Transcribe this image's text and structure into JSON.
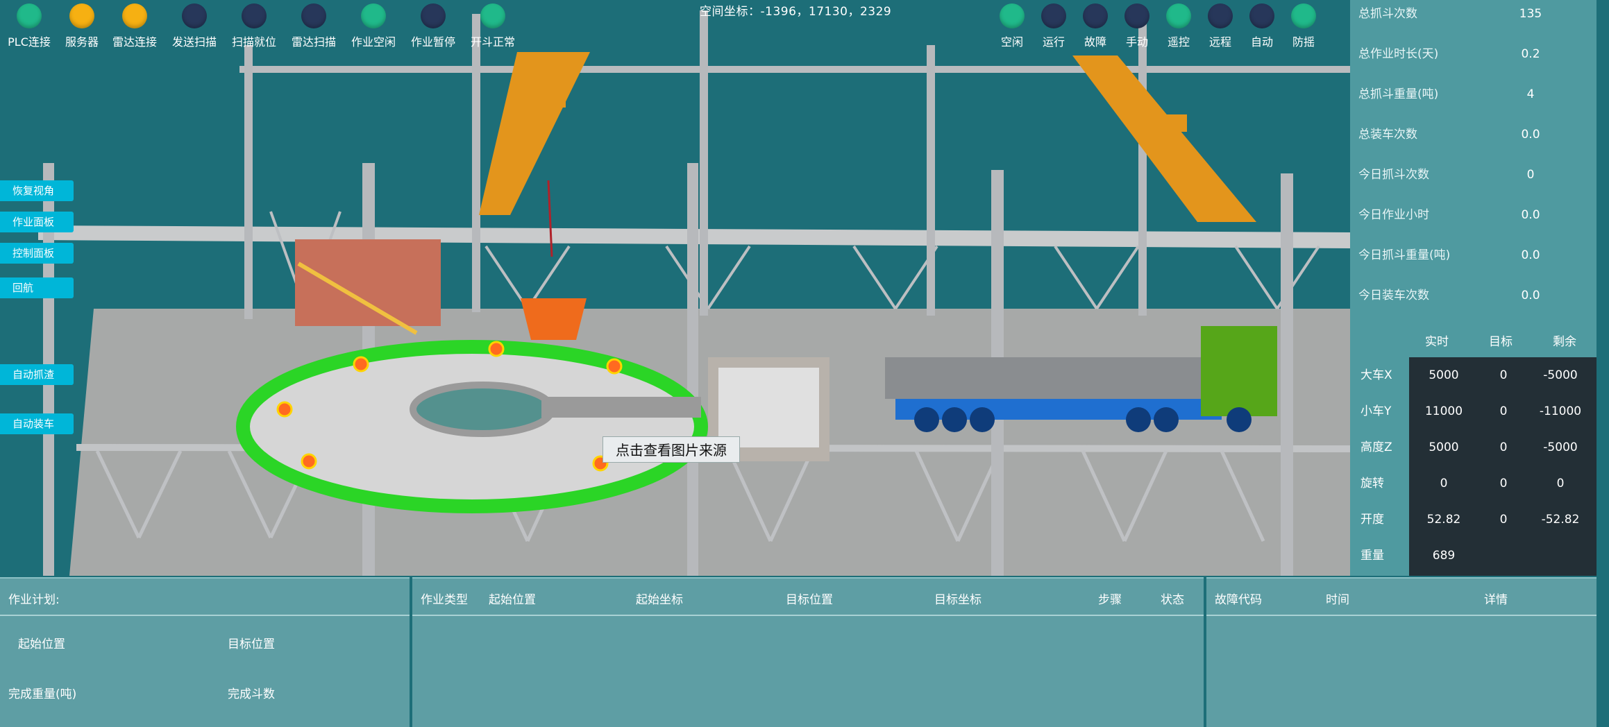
{
  "coords": "空间坐标：-1396，17130，2329",
  "indicators_left": [
    {
      "label": "PLC连接",
      "color": "#20b98a"
    },
    {
      "label": "服务器",
      "color": "#f6b012"
    },
    {
      "label": "雷达连接",
      "color": "#f6b012"
    },
    {
      "label": "发送扫描",
      "color": "#27375a"
    },
    {
      "label": "扫描就位",
      "color": "#27375a"
    },
    {
      "label": "雷达扫描",
      "color": "#27375a"
    },
    {
      "label": "作业空闲",
      "color": "#20b98a"
    },
    {
      "label": "作业暂停",
      "color": "#27375a"
    },
    {
      "label": "开斗正常",
      "color": "#20b98a"
    }
  ],
  "indicators_right": [
    {
      "label": "空闲",
      "color": "#20b98a"
    },
    {
      "label": "运行",
      "color": "#27375a"
    },
    {
      "label": "故障",
      "color": "#27375a"
    },
    {
      "label": "手动",
      "color": "#27375a"
    },
    {
      "label": "遥控",
      "color": "#20b98a"
    },
    {
      "label": "远程",
      "color": "#27375a"
    },
    {
      "label": "自动",
      "color": "#27375a"
    },
    {
      "label": "防摇",
      "color": "#20b98a"
    }
  ],
  "side_buttons": [
    "恢复视角",
    "作业面板",
    "控制面板",
    "回航",
    "自动抓渣",
    "自动装车"
  ],
  "stats": [
    {
      "label": "总抓斗次数",
      "value": "135"
    },
    {
      "label": "总作业时长(天)",
      "value": "0.2"
    },
    {
      "label": "总抓斗重量(吨)",
      "value": "4"
    },
    {
      "label": "总装车次数",
      "value": "0.0"
    },
    {
      "label": "今日抓斗次数",
      "value": "0"
    },
    {
      "label": "今日作业小时",
      "value": "0.0"
    },
    {
      "label": "今日抓斗重量(吨)",
      "value": "0.0"
    },
    {
      "label": "今日装车次数",
      "value": "0.0"
    }
  ],
  "motion": {
    "headers": [
      "实时",
      "目标",
      "剩余"
    ],
    "rows": [
      {
        "label": "大车X",
        "realtime": "5000",
        "target": "0",
        "remain": "-5000"
      },
      {
        "label": "小车Y",
        "realtime": "11000",
        "target": "0",
        "remain": "-11000"
      },
      {
        "label": "高度Z",
        "realtime": "5000",
        "target": "0",
        "remain": "-5000"
      },
      {
        "label": "旋转",
        "realtime": "0",
        "target": "0",
        "remain": "0"
      },
      {
        "label": "开度",
        "realtime": "52.82",
        "target": "0",
        "remain": "-52.82"
      },
      {
        "label": "重量",
        "realtime": "689",
        "target": "",
        "remain": ""
      }
    ]
  },
  "plan": {
    "title": "作业计划:",
    "start_label": "起始位置",
    "target_label": "目标位置",
    "weight_label": "完成重量(吨)",
    "count_label": "完成斗数"
  },
  "task_columns": [
    "作业类型",
    "起始位置",
    "起始坐标",
    "目标位置",
    "目标坐标",
    "步骤",
    "状态"
  ],
  "fault_columns": [
    "故障代码",
    "时间",
    "详情"
  ],
  "tooltip": "点击查看图片来源"
}
